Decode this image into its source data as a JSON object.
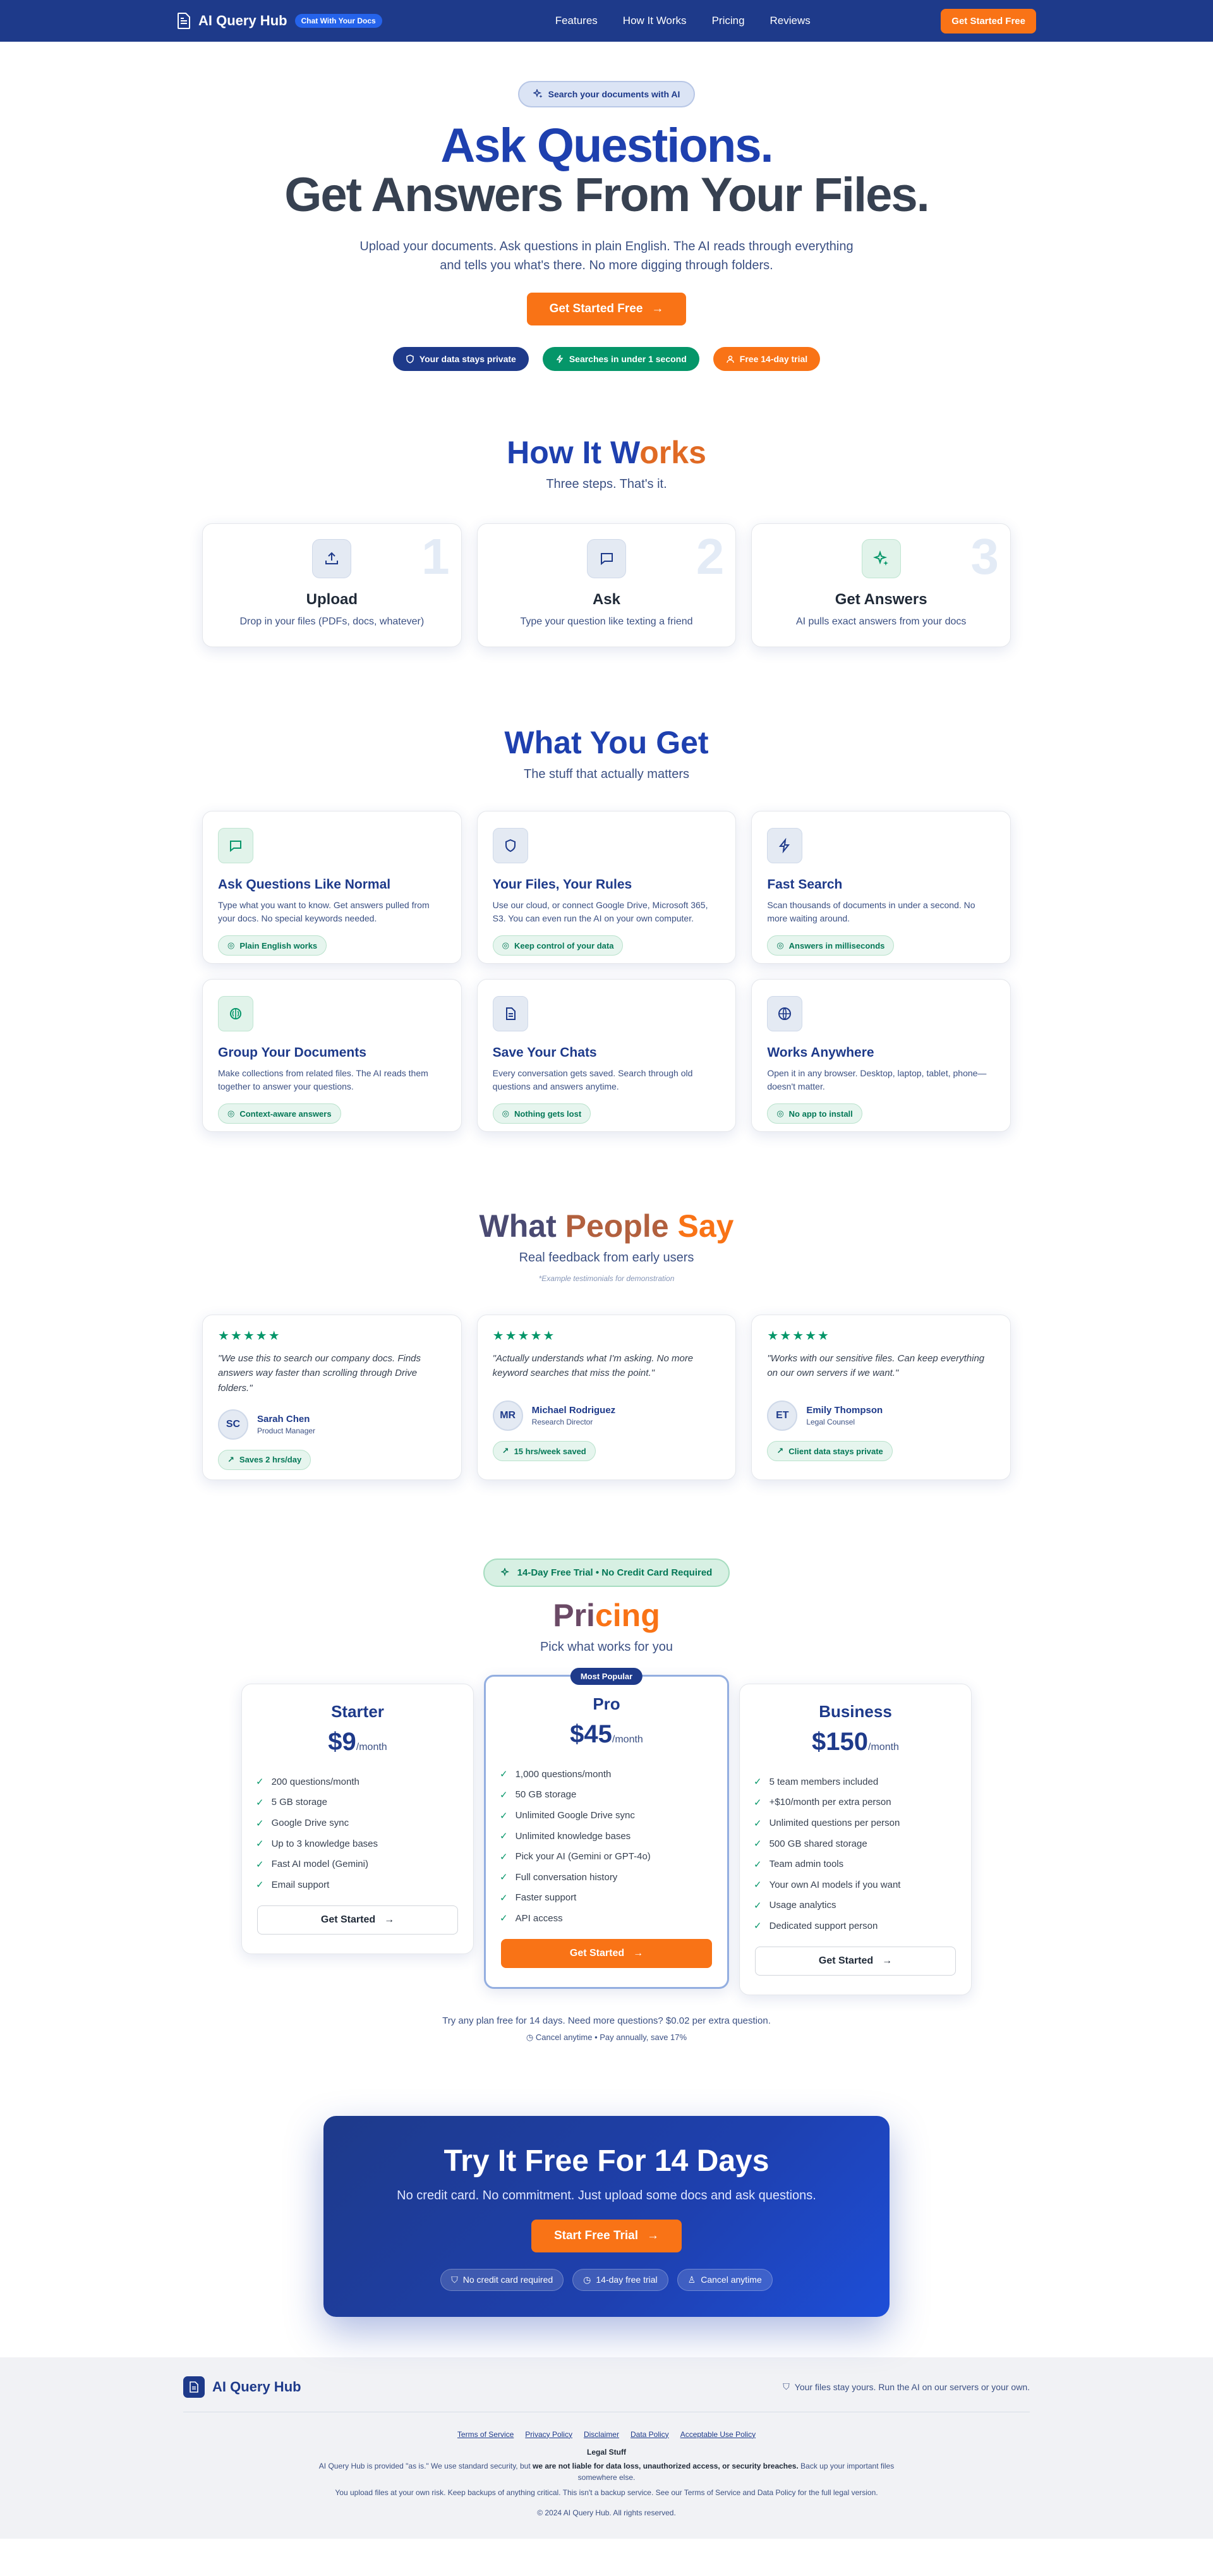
{
  "nav": {
    "brand": "AI Query Hub",
    "badge": "Chat With Your Docs",
    "links": [
      "Features",
      "How It Works",
      "Pricing",
      "Reviews"
    ],
    "cta": "Get Started Free"
  },
  "hero": {
    "pill": "Search your documents with AI",
    "title_line1": "Ask Questions.",
    "title_line2": "Get Answers From Your Files.",
    "subtitle": "Upload your documents. Ask questions in plain English. The AI reads through everything and tells you what's there. No more digging through folders.",
    "cta": "Get Started Free",
    "trust": [
      {
        "label": "Your data stays private",
        "color": "#1e3a8a"
      },
      {
        "label": "Searches in under 1 second",
        "color": "#059669"
      },
      {
        "label": "Free 14-day trial",
        "color": "#f97316"
      }
    ]
  },
  "how": {
    "title_a": "How It W",
    "title_b": "orks",
    "subtitle": "Three steps. That's it.",
    "steps": [
      {
        "num": "1",
        "title": "Upload",
        "desc": "Drop in your files (PDFs, docs, whatever)",
        "icon": "upload-icon"
      },
      {
        "num": "2",
        "title": "Ask",
        "desc": "Type your question like texting a friend",
        "icon": "chat-icon"
      },
      {
        "num": "3",
        "title": "Get Answers",
        "desc": "AI pulls exact answers from your docs",
        "icon": "sparkle-icon"
      }
    ]
  },
  "get": {
    "title": "What You Get",
    "subtitle": "The stuff that actually matters",
    "features": [
      {
        "title": "Ask Questions Like Normal",
        "desc": "Type what you want to know. Get answers pulled from your docs. No special keywords needed.",
        "tag": "Plain English works",
        "icon": "chat-icon"
      },
      {
        "title": "Your Files, Your Rules",
        "desc": "Use our cloud, or connect Google Drive, Microsoft 365, S3. You can even run the AI on your own computer.",
        "tag": "Keep control of your data",
        "icon": "shield-icon"
      },
      {
        "title": "Fast Search",
        "desc": "Scan thousands of documents in under a second. No more waiting around.",
        "tag": "Answers in milliseconds",
        "icon": "lightning-icon"
      },
      {
        "title": "Group Your Documents",
        "desc": "Make collections from related files. The AI reads them together to answer your questions.",
        "tag": "Context-aware answers",
        "icon": "brain-icon"
      },
      {
        "title": "Save Your Chats",
        "desc": "Every conversation gets saved. Search through old questions and answers anytime.",
        "tag": "Nothing gets lost",
        "icon": "document-icon"
      },
      {
        "title": "Works Anywhere",
        "desc": "Open it in any browser. Desktop, laptop, tablet, phone—doesn't matter.",
        "tag": "No app to install",
        "icon": "globe-icon"
      }
    ]
  },
  "say": {
    "title_a": "What ",
    "title_b": "People",
    "title_c": " Say",
    "subtitle": "Real feedback from early users",
    "note": "*Example testimonials for demonstration",
    "stars": "★★★★★",
    "items": [
      {
        "quote": "\"We use this to search our company docs. Finds answers way faster than scrolling through Drive folders.\"",
        "initials": "SC",
        "name": "Sarah Chen",
        "role": "Product Manager",
        "tag": "Saves 2 hrs/day"
      },
      {
        "quote": "\"Actually understands what I'm asking. No more keyword searches that miss the point.\"",
        "initials": "MR",
        "name": "Michael Rodriguez",
        "role": "Research Director",
        "tag": "15 hrs/week saved"
      },
      {
        "quote": "\"Works with our sensitive files. Can keep everything on our own servers if we want.\"",
        "initials": "ET",
        "name": "Emily Thompson",
        "role": "Legal Counsel",
        "tag": "Client data stays private"
      }
    ]
  },
  "pricing": {
    "pill": "14-Day Free Trial • No Credit Card Required",
    "title_a": "Pri",
    "title_b": "cing",
    "subtitle": "Pick what works for you",
    "plans": [
      {
        "name": "Starter",
        "price": "$9",
        "per": "/month",
        "features": [
          "200 questions/month",
          "5 GB storage",
          "Google Drive sync",
          "Up to 3 knowledge bases",
          "Fast AI model (Gemini)",
          "Email support"
        ],
        "cta": "Get Started"
      },
      {
        "name": "Pro",
        "badge": "Most Popular",
        "price": "$45",
        "per": "/month",
        "features": [
          "1,000 questions/month",
          "50 GB storage",
          "Unlimited Google Drive sync",
          "Unlimited knowledge bases",
          "Pick your AI (Gemini or GPT-4o)",
          "Full conversation history",
          "Faster support",
          "API access"
        ],
        "cta": "Get Started"
      },
      {
        "name": "Business",
        "price": "$150",
        "per": "/month",
        "features": [
          "5 team members included",
          "+$10/month per extra person",
          "Unlimited questions per person",
          "500 GB shared storage",
          "Team admin tools",
          "Your own AI models if you want",
          "Usage analytics",
          "Dedicated support person"
        ],
        "cta": "Get Started"
      }
    ],
    "note": "Try any plan free for 14 days. Need more questions? $0.02 per extra question.",
    "note2": "Cancel anytime • Pay annually, save 17%"
  },
  "cta": {
    "title": "Try It Free For 14 Days",
    "subtitle": "No credit card. No commitment. Just upload some docs and ask questions.",
    "button": "Start Free Trial",
    "tags": [
      "No credit card required",
      "14-day free trial",
      "Cancel anytime"
    ]
  },
  "footer": {
    "brand": "AI Query Hub",
    "note": "Your files stay yours. Run the AI on our servers or your own.",
    "links": [
      "Terms of Service",
      "Privacy Policy",
      "Disclaimer",
      "Data Policy",
      "Acceptable Use Policy"
    ],
    "legal_title": "Legal Stuff",
    "legal_1a": "AI Query Hub is provided \"as is.\" We use standard security, but ",
    "legal_1b": "we are not liable for data loss, unauthorized access, or security breaches.",
    "legal_1c": " Back up your important files somewhere else.",
    "legal_2": "You upload files at your own risk. Keep backups of anything critical. This isn't a backup service. See our Terms of Service and Data Policy for the full legal version.",
    "copyright": "© 2024 AI Query Hub. All rights reserved."
  },
  "colors": {
    "navy": "#1e3a8a",
    "blue": "#1e40af",
    "orange": "#f97316",
    "green": "#059669"
  }
}
